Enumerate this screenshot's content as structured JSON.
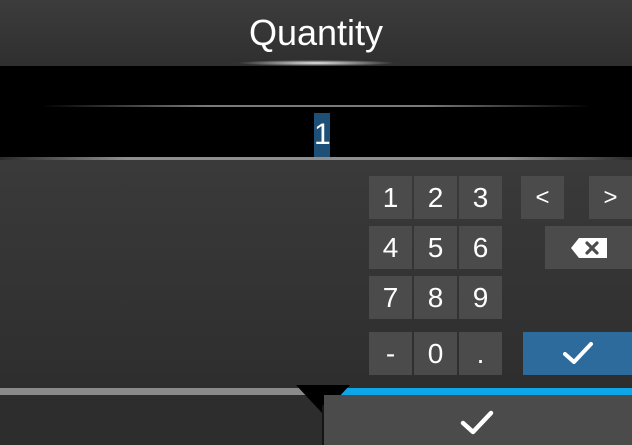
{
  "header": {
    "title": "Quantity"
  },
  "input": {
    "value": "1"
  },
  "keypad": {
    "keys": [
      {
        "id": "1",
        "label": "1"
      },
      {
        "id": "2",
        "label": "2"
      },
      {
        "id": "3",
        "label": "3"
      },
      {
        "id": "left",
        "label": "<"
      },
      {
        "id": "right",
        "label": ">"
      },
      {
        "id": "4",
        "label": "4"
      },
      {
        "id": "5",
        "label": "5"
      },
      {
        "id": "6",
        "label": "6"
      },
      {
        "id": "backspace",
        "icon": "backspace-icon"
      },
      {
        "id": "7",
        "label": "7"
      },
      {
        "id": "8",
        "label": "8"
      },
      {
        "id": "9",
        "label": "9"
      },
      {
        "id": "minus",
        "label": "-"
      },
      {
        "id": "0",
        "label": "0"
      },
      {
        "id": "dot",
        "label": "."
      },
      {
        "id": "enter",
        "icon": "checkmark-icon"
      }
    ]
  },
  "footer": {
    "confirm_icon": "checkmark-icon"
  },
  "colors": {
    "accent": "#2c6b9c",
    "tab_active": "#0ea6e8",
    "key_bg": "#4b4b4b"
  }
}
